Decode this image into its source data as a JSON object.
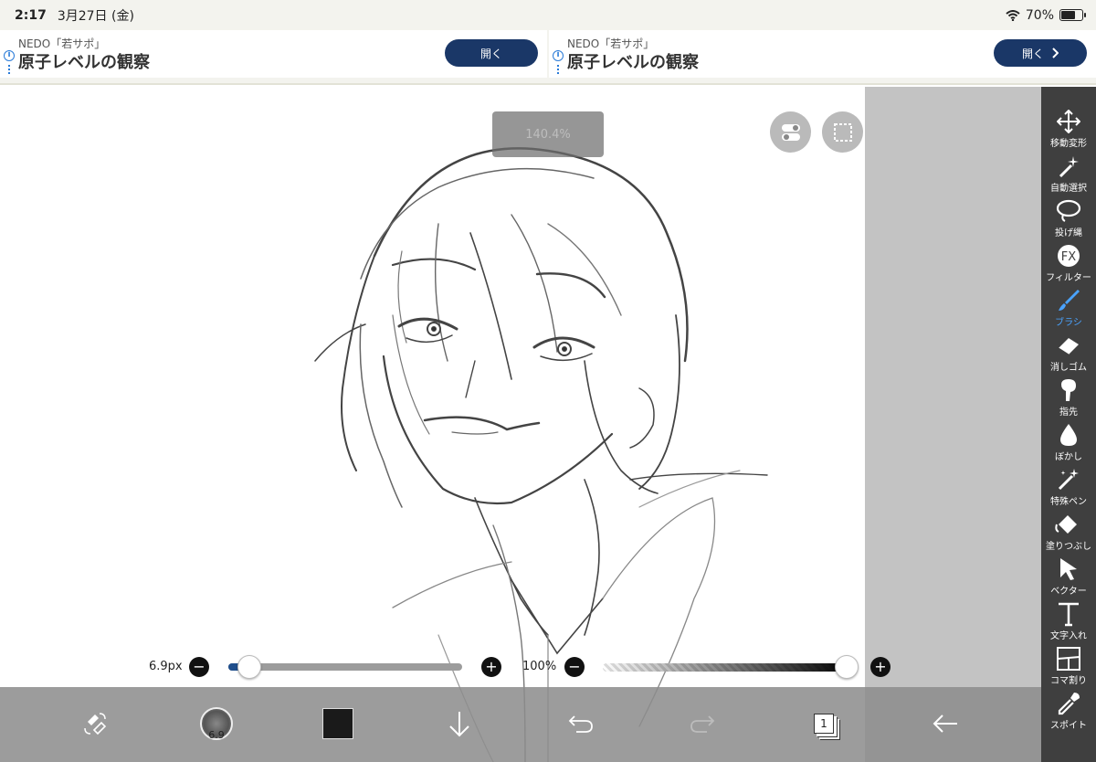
{
  "status": {
    "time": "2:17",
    "date": "3月27日 (金)",
    "battery": "70%",
    "battery_level": 0.7
  },
  "ads": [
    {
      "sponsor": "NEDO「若サポ」",
      "headline": "原子レベルの観察",
      "button": "開く",
      "chevron": false
    },
    {
      "sponsor": "NEDO「若サポ」",
      "headline": "原子レベルの観察",
      "button": "開く",
      "chevron": true
    }
  ],
  "canvas": {
    "zoom_toast": "140.4%"
  },
  "brush": {
    "size_label": "6.9px",
    "size_fraction": 0.09,
    "preview_label": "6.9"
  },
  "opacity": {
    "label": "100%",
    "value_fraction": 1.0
  },
  "colors": {
    "active_tool": "#4aa3ff",
    "ad_button": "#1a3767",
    "current_color": "#1a1a1a"
  },
  "layers": {
    "count_badge": "1"
  },
  "tools": [
    {
      "label": "移動変形",
      "icon": "move-icon",
      "active": false
    },
    {
      "label": "自動選択",
      "icon": "magic-wand-icon",
      "active": false
    },
    {
      "label": "投げ縄",
      "icon": "lasso-icon",
      "active": false
    },
    {
      "label": "フィルター",
      "icon": "fx-icon",
      "active": false
    },
    {
      "label": "ブラシ",
      "icon": "brush-icon",
      "active": true
    },
    {
      "label": "消しゴム",
      "icon": "eraser-icon",
      "active": false
    },
    {
      "label": "指先",
      "icon": "finger-icon",
      "active": false
    },
    {
      "label": "ぼかし",
      "icon": "blur-drop-icon",
      "active": false
    },
    {
      "label": "特殊ペン",
      "icon": "special-pen-icon",
      "active": false
    },
    {
      "label": "塗りつぶし",
      "icon": "fill-icon",
      "active": false
    },
    {
      "label": "ベクター",
      "icon": "vector-cursor-icon",
      "active": false
    },
    {
      "label": "文字入れ",
      "icon": "text-icon",
      "active": false
    },
    {
      "label": "コマ割り",
      "icon": "panel-icon",
      "active": false
    },
    {
      "label": "スポイト",
      "icon": "eyedropper-icon",
      "active": false
    }
  ]
}
